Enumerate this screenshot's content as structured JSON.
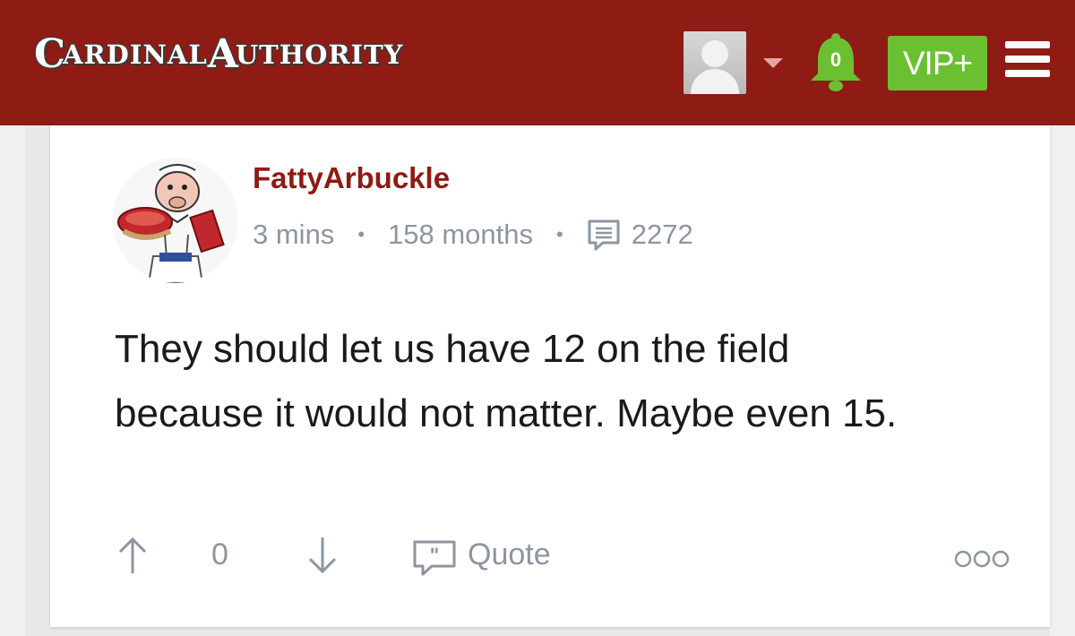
{
  "header": {
    "logo_first": "C",
    "logo_rest1": "ARDINAL ",
    "logo_second": "A",
    "logo_rest2": "UTHORITY",
    "notification_count": "0",
    "vip_label": "VIP+",
    "brand_color": "#8e1b14",
    "accent_green": "#6bc031"
  },
  "post": {
    "username": "FattyArbuckle",
    "time_ago": "3 mins",
    "member_for": "158 months",
    "post_count": "2272",
    "body_line1": "They should let us have 12 on the field",
    "body_line2": "because it would not matter. Maybe even 15.",
    "vote_count": "0",
    "quote_label": "Quote",
    "icons": [
      "comments-icon",
      "upvote-arrow-icon",
      "downvote-arrow-icon",
      "quote-icon",
      "more-options-icon"
    ]
  }
}
